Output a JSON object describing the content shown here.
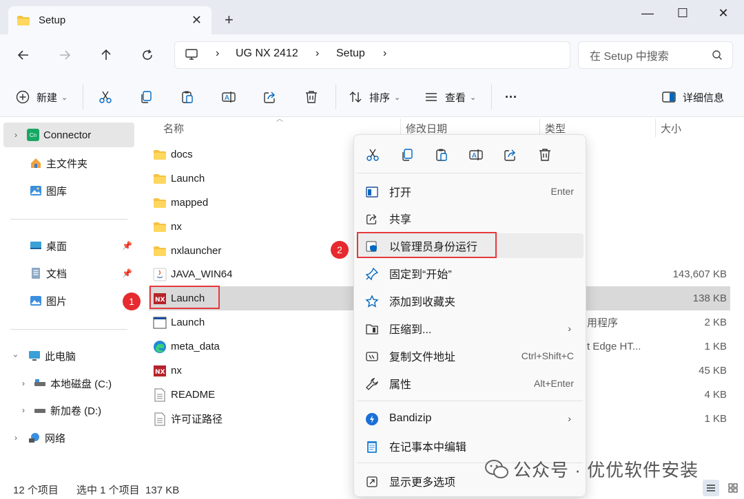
{
  "window": {
    "tab_title": "Setup",
    "tab_close": "✕",
    "new_tab": "+",
    "minimize": "—",
    "maximize": "☐",
    "close": "✕"
  },
  "nav": {
    "path": [
      "UG NX 2412",
      "Setup"
    ],
    "search_placeholder": "在 Setup 中搜索"
  },
  "toolbar": {
    "new_label": "新建",
    "sort_label": "排序",
    "view_label": "查看",
    "more_label": "···",
    "details_label": "详细信息"
  },
  "sidebar": {
    "items": [
      {
        "label": "Connector",
        "icon": "connector-icon"
      },
      {
        "label": "主文件夹",
        "icon": "home-icon"
      },
      {
        "label": "图库",
        "icon": "gallery-icon"
      },
      {
        "label": "桌面",
        "icon": "desktop-icon"
      },
      {
        "label": "文档",
        "icon": "documents-icon"
      },
      {
        "label": "图片",
        "icon": "pictures-icon"
      },
      {
        "label": "此电脑",
        "icon": "this-pc-icon"
      },
      {
        "label": "本地磁盘 (C:)",
        "icon": "drive-icon"
      },
      {
        "label": "新加卷 (D:)",
        "icon": "drive-icon"
      },
      {
        "label": "网络",
        "icon": "network-icon"
      }
    ]
  },
  "columns": {
    "name": "名称",
    "modified": "修改日期",
    "type": "类型",
    "size": "大小"
  },
  "files": [
    {
      "name": "docs",
      "type": "",
      "size": "",
      "icon": "folder-icon"
    },
    {
      "name": "Launch",
      "type": "",
      "size": "",
      "icon": "folder-icon"
    },
    {
      "name": "mapped",
      "type": "",
      "size": "",
      "icon": "folder-icon"
    },
    {
      "name": "nx",
      "type": "",
      "size": "",
      "icon": "folder-icon"
    },
    {
      "name": "nxlauncher",
      "type": "",
      "size": "",
      "icon": "folder-icon"
    },
    {
      "name": "JAVA_WIN64",
      "type": "",
      "size": "143,607 KB",
      "icon": "java-icon"
    },
    {
      "name": "Launch",
      "type": "",
      "size": "138 KB",
      "icon": "nx-app-icon"
    },
    {
      "name": "Launch",
      "type": "用程序",
      "size": "2 KB",
      "icon": "window-app-icon"
    },
    {
      "name": "meta_data",
      "type": "t Edge HT...",
      "size": "1 KB",
      "icon": "edge-icon"
    },
    {
      "name": "nx",
      "type": "",
      "size": "45 KB",
      "icon": "nx-app-icon"
    },
    {
      "name": "README",
      "type": "",
      "size": "4 KB",
      "icon": "text-file-icon"
    },
    {
      "name": "许可证路径",
      "type": "",
      "size": "1 KB",
      "icon": "text-file-icon"
    }
  ],
  "annotations": {
    "badge1": "1",
    "badge2": "2"
  },
  "context_menu": {
    "items": [
      {
        "label": "打开",
        "shortcut": "Enter",
        "icon": "open-icon"
      },
      {
        "label": "共享",
        "shortcut": "",
        "icon": "share-icon"
      },
      {
        "label": "以管理员身份运行",
        "shortcut": "",
        "icon": "admin-shield-icon"
      },
      {
        "label": "固定到“开始”",
        "shortcut": "",
        "icon": "pin-icon"
      },
      {
        "label": "添加到收藏夹",
        "shortcut": "",
        "icon": "star-icon"
      },
      {
        "label": "压缩到...",
        "shortcut": "",
        "icon": "zip-folder-icon"
      },
      {
        "label": "复制文件地址",
        "shortcut": "Ctrl+Shift+C",
        "icon": "copy-path-icon"
      },
      {
        "label": "属性",
        "shortcut": "Alt+Enter",
        "icon": "wrench-icon"
      },
      {
        "label": "Bandizip",
        "shortcut": "",
        "icon": "bandizip-icon"
      },
      {
        "label": "在记事本中编辑",
        "shortcut": "",
        "icon": "notepad-icon"
      },
      {
        "label": "显示更多选项",
        "shortcut": "",
        "icon": "more-options-icon"
      }
    ],
    "arrow": "›"
  },
  "status": {
    "count": "12 个项目",
    "selection": "选中 1 个项目  137 KB"
  },
  "watermark": "公众号 · 优优软件安装",
  "colors": {
    "accent": "#0067c0",
    "highlight_red": "#e5383b",
    "folder_yellow": "#f5c242",
    "nx_red": "#b5232a"
  }
}
